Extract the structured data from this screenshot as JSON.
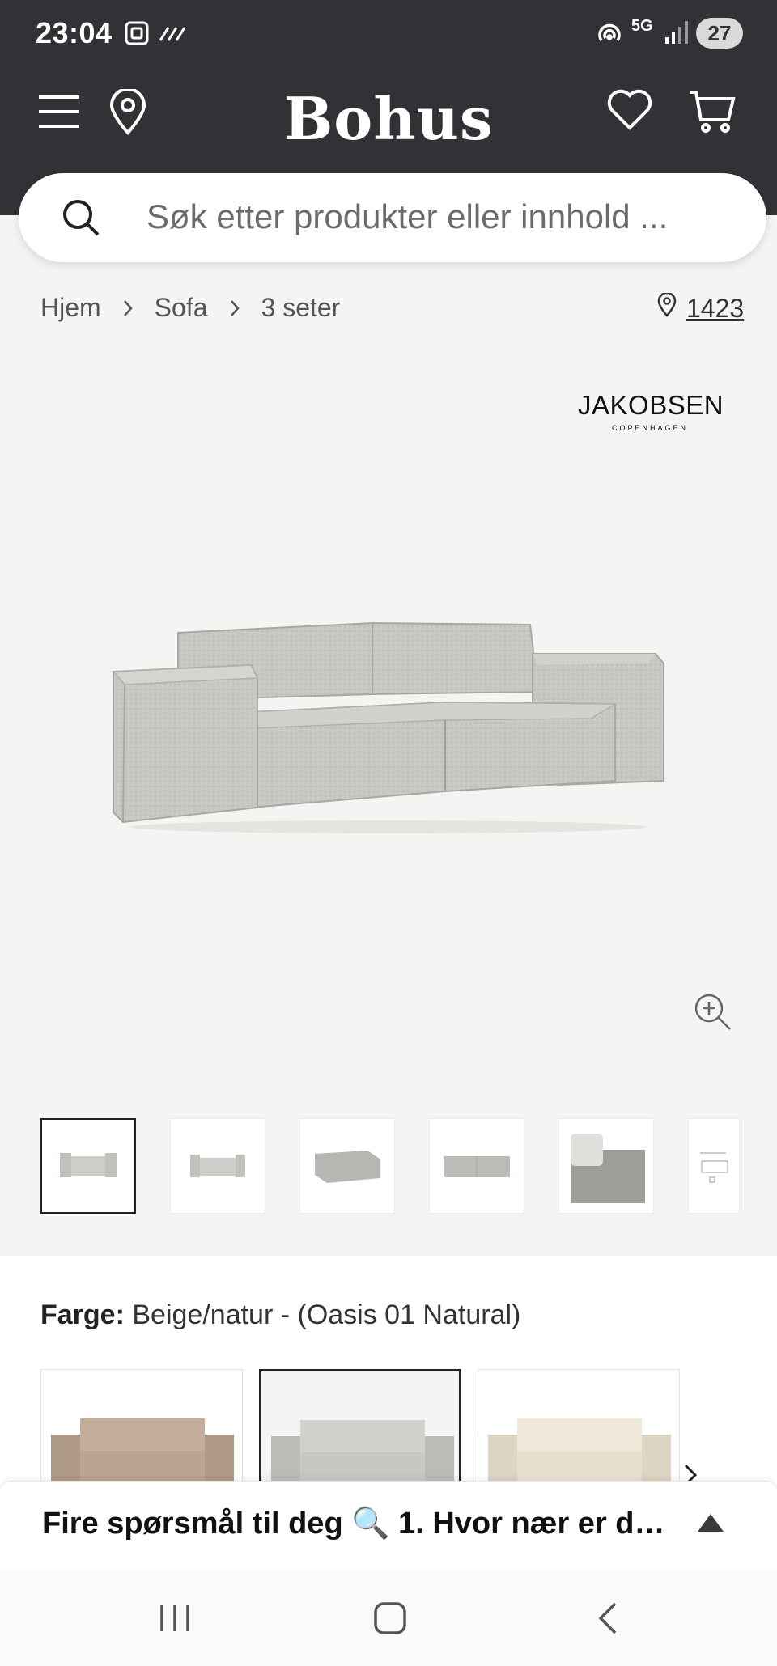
{
  "status": {
    "time": "23:04",
    "network": "5G",
    "battery": "27",
    "icons": [
      "screenshot-icon",
      "data-activity-icon",
      "hotspot-icon",
      "signal-icon"
    ]
  },
  "header": {
    "logo": "Bohus",
    "icons": [
      "menu-icon",
      "location-pin-icon",
      "heart-icon",
      "cart-icon"
    ]
  },
  "search": {
    "placeholder": "Søk etter produkter eller innhold ..."
  },
  "breadcrumb": {
    "items": [
      "Hjem",
      "Sofa",
      "3 seter"
    ]
  },
  "store": {
    "number": "1423"
  },
  "product": {
    "brand": "JAKOBSEN",
    "brand_sub": "COPENHAGEN",
    "thumbnail_count": 6
  },
  "color": {
    "label": "Farge:",
    "value": "Beige/natur - (Oasis 01 Natural)",
    "swatches": [
      {
        "color": "#b9a592"
      },
      {
        "color": "#c9c7c4"
      },
      {
        "color": "#e8e0cf"
      }
    ]
  },
  "chat": {
    "text": "Fire spørsmål til deg 🔍 1. Hvor nær er du ..."
  },
  "colors": {
    "header_bg": "#323236",
    "page_bg": "#f5f4f2"
  }
}
